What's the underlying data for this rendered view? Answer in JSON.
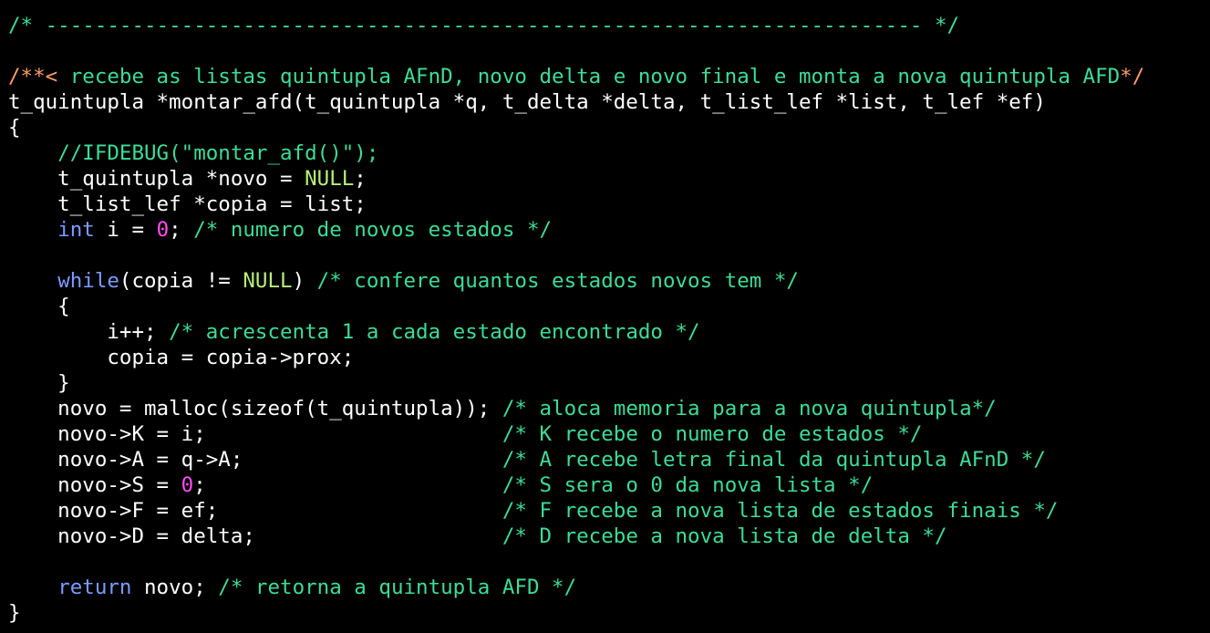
{
  "colors": {
    "background": "#000000",
    "plain": "#ffffff",
    "comment": "#3ddc97",
    "doc_comment": "#ff9e64",
    "keyword": "#7c9cff",
    "constant": "#b6f07a",
    "number": "#ff4df0"
  },
  "code": {
    "lines": [
      [
        {
          "t": "comment",
          "v": "/* ----------------------------------------------------------------------- */"
        }
      ],
      [],
      [
        {
          "t": "doc",
          "v": "/**< "
        },
        {
          "t": "comment",
          "v": "recebe as listas quintupla AFnD, novo delta e novo final e monta a nova quintupla AFD"
        },
        {
          "t": "doc",
          "v": "*/"
        }
      ],
      [
        {
          "t": "plain",
          "v": "t_quintupla *montar_afd(t_quintupla *q, t_delta *delta, t_list_lef *list, t_lef *ef)"
        }
      ],
      [
        {
          "t": "plain",
          "v": "{"
        }
      ],
      [
        {
          "t": "plain",
          "v": "    "
        },
        {
          "t": "comment",
          "v": "//IFDEBUG(\"montar_afd()\");"
        }
      ],
      [
        {
          "t": "plain",
          "v": "    t_quintupla *novo = "
        },
        {
          "t": "const",
          "v": "NULL"
        },
        {
          "t": "plain",
          "v": ";"
        }
      ],
      [
        {
          "t": "plain",
          "v": "    t_list_lef *copia = list;"
        }
      ],
      [
        {
          "t": "plain",
          "v": "    "
        },
        {
          "t": "keyword",
          "v": "int"
        },
        {
          "t": "plain",
          "v": " i = "
        },
        {
          "t": "number",
          "v": "0"
        },
        {
          "t": "plain",
          "v": "; "
        },
        {
          "t": "comment",
          "v": "/* numero de novos estados */"
        }
      ],
      [],
      [
        {
          "t": "plain",
          "v": "    "
        },
        {
          "t": "keyword",
          "v": "while"
        },
        {
          "t": "plain",
          "v": "(copia != "
        },
        {
          "t": "const",
          "v": "NULL"
        },
        {
          "t": "plain",
          "v": ") "
        },
        {
          "t": "comment",
          "v": "/* confere quantos estados novos tem */"
        }
      ],
      [
        {
          "t": "plain",
          "v": "    {"
        }
      ],
      [
        {
          "t": "plain",
          "v": "        i++; "
        },
        {
          "t": "comment",
          "v": "/* acrescenta 1 a cada estado encontrado */"
        }
      ],
      [
        {
          "t": "plain",
          "v": "        copia = copia->prox;"
        }
      ],
      [
        {
          "t": "plain",
          "v": "    }"
        }
      ],
      [
        {
          "t": "plain",
          "v": "    novo = malloc(sizeof(t_quintupla)); "
        },
        {
          "t": "comment",
          "v": "/* aloca memoria para a nova quintupla*/"
        }
      ],
      [
        {
          "t": "plain",
          "v": "    novo->K = i;                        "
        },
        {
          "t": "comment",
          "v": "/* K recebe o numero de estados */"
        }
      ],
      [
        {
          "t": "plain",
          "v": "    novo->A = q->A;                     "
        },
        {
          "t": "comment",
          "v": "/* A recebe letra final da quintupla AFnD */"
        }
      ],
      [
        {
          "t": "plain",
          "v": "    novo->S = "
        },
        {
          "t": "number",
          "v": "0"
        },
        {
          "t": "plain",
          "v": ";                        "
        },
        {
          "t": "comment",
          "v": "/* S sera o 0 da nova lista */"
        }
      ],
      [
        {
          "t": "plain",
          "v": "    novo->F = ef;                       "
        },
        {
          "t": "comment",
          "v": "/* F recebe a nova lista de estados finais */"
        }
      ],
      [
        {
          "t": "plain",
          "v": "    novo->D = delta;                    "
        },
        {
          "t": "comment",
          "v": "/* D recebe a nova lista de delta */"
        }
      ],
      [],
      [
        {
          "t": "plain",
          "v": "    "
        },
        {
          "t": "keyword",
          "v": "return"
        },
        {
          "t": "plain",
          "v": " novo; "
        },
        {
          "t": "comment",
          "v": "/* retorna a quintupla AFD */"
        }
      ],
      [
        {
          "t": "plain",
          "v": "}"
        }
      ]
    ]
  }
}
